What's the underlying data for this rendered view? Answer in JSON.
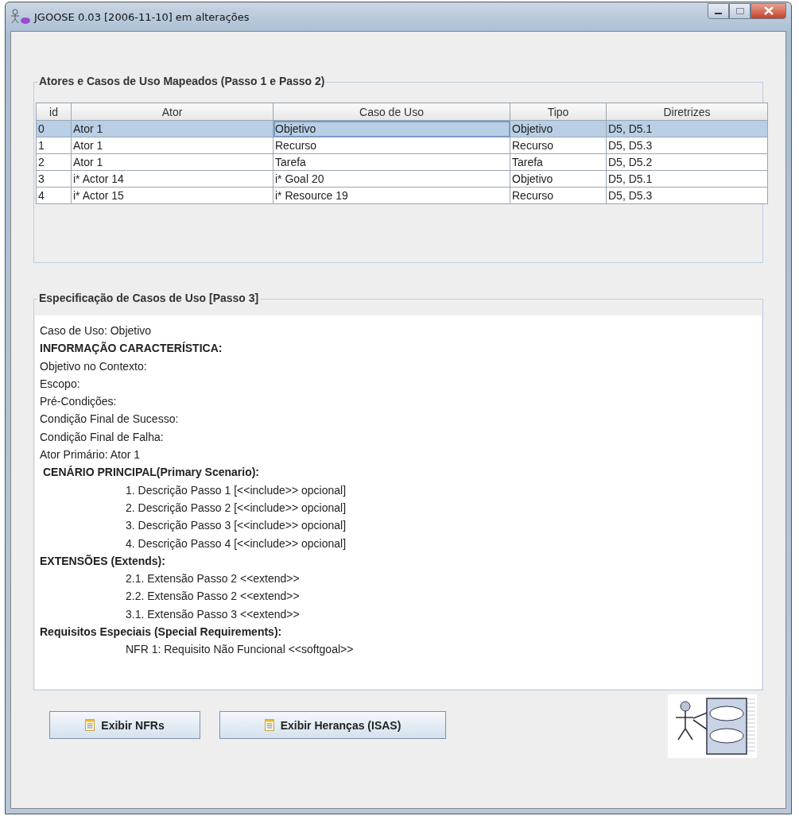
{
  "window": {
    "title": "JGOOSE 0.03 [2006-11-10] em alterações"
  },
  "mapped_group": {
    "title": "Atores e Casos de Uso Mapeados (Passo 1 e Passo 2)",
    "table": {
      "columns": [
        "id",
        "Ator",
        "Caso de Uso",
        "Tipo",
        "Diretrizes"
      ],
      "rows": [
        {
          "cells": [
            "0",
            "Ator 1",
            "Objetivo",
            "Objetivo",
            "D5, D5.1"
          ],
          "selected": true
        },
        {
          "cells": [
            "1",
            "Ator 1",
            "Recurso",
            "Recurso",
            "D5, D5.3"
          ],
          "selected": false
        },
        {
          "cells": [
            "2",
            "Ator 1",
            "Tarefa",
            "Tarefa",
            "D5, D5.2"
          ],
          "selected": false
        },
        {
          "cells": [
            "3",
            "i* Actor 14",
            "i* Goal 20",
            "Objetivo",
            "D5, D5.1"
          ],
          "selected": false
        },
        {
          "cells": [
            "4",
            "i* Actor 15",
            "i* Resource 19",
            "Recurso",
            "D5, D5.3"
          ],
          "selected": false
        }
      ]
    }
  },
  "spec_group": {
    "title": "Especificação de Casos de Uso [Passo 3]",
    "lines": [
      {
        "kind": "plain",
        "text": "Caso de Uso: Objetivo"
      },
      {
        "kind": "heading",
        "text": "INFORMAÇÃO CARACTERÍSTICA:"
      },
      {
        "kind": "plain",
        "text": "Objetivo no Contexto:"
      },
      {
        "kind": "plain",
        "text": "Escopo:"
      },
      {
        "kind": "plain",
        "text": "Pré-Condições:"
      },
      {
        "kind": "plain",
        "text": "Condição Final de Sucesso:"
      },
      {
        "kind": "plain",
        "text": "Condição Final de Falha:"
      },
      {
        "kind": "plain",
        "text": "Ator Primário: Ator 1"
      },
      {
        "kind": "subheading",
        "text": "CENÁRIO PRINCIPAL(Primary Scenario):"
      },
      {
        "kind": "step",
        "text": "1. Descrição Passo 1 [<<include>> opcional]"
      },
      {
        "kind": "step",
        "text": "2. Descrição Passo 2 [<<include>> opcional]"
      },
      {
        "kind": "step",
        "text": "3. Descrição Passo 3 [<<include>> opcional]"
      },
      {
        "kind": "step",
        "text": "4. Descrição Passo 4 [<<include>> opcional]"
      },
      {
        "kind": "heading",
        "text": "EXTENSÕES (Extends):"
      },
      {
        "kind": "step",
        "text": "2.1. Extensão Passo 2 <<extend>>"
      },
      {
        "kind": "step",
        "text": "2.2. Extensão Passo 2 <<extend>>"
      },
      {
        "kind": "step",
        "text": "3.1. Extensão Passo 3 <<extend>>"
      },
      {
        "kind": "heading",
        "text": "Requisitos Especiais (Special Requirements):"
      },
      {
        "kind": "step",
        "text": "NFR 1: Requisito Não Funcional <<softgoal>>"
      }
    ]
  },
  "buttons": [
    {
      "label": "Exibir NFRs"
    },
    {
      "label": "Exibir Heranças (ISAS)"
    }
  ]
}
